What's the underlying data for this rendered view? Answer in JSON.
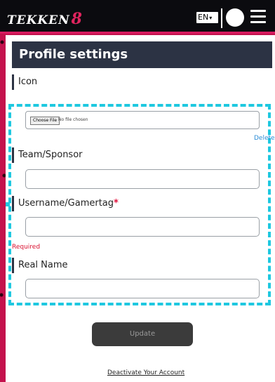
{
  "header": {
    "logo_text": "TEKKEN",
    "logo_number": "8",
    "language": "EN",
    "menu_icon": "hamburger-icon",
    "avatar_icon": "avatar"
  },
  "page": {
    "title": "Profile settings",
    "icon_label": "Icon",
    "file_button": "Choose File",
    "file_status": "No file chosen",
    "delete_link": "Delete",
    "team_label": "Team/Sponsor",
    "team_value": "",
    "username_label": "Username/Gamertag",
    "username_required_mark": "*",
    "username_value": "",
    "required_text": "Required",
    "realname_label": "Real Name",
    "realname_value": "",
    "update_button": "Update",
    "deactivate_link": "Deactivate Your Account"
  },
  "colors": {
    "accent": "#e0245e",
    "title_bar": "#2c3344",
    "highlight": "#1ec8e0",
    "link": "#2b8cd6",
    "error": "#d9102f"
  }
}
